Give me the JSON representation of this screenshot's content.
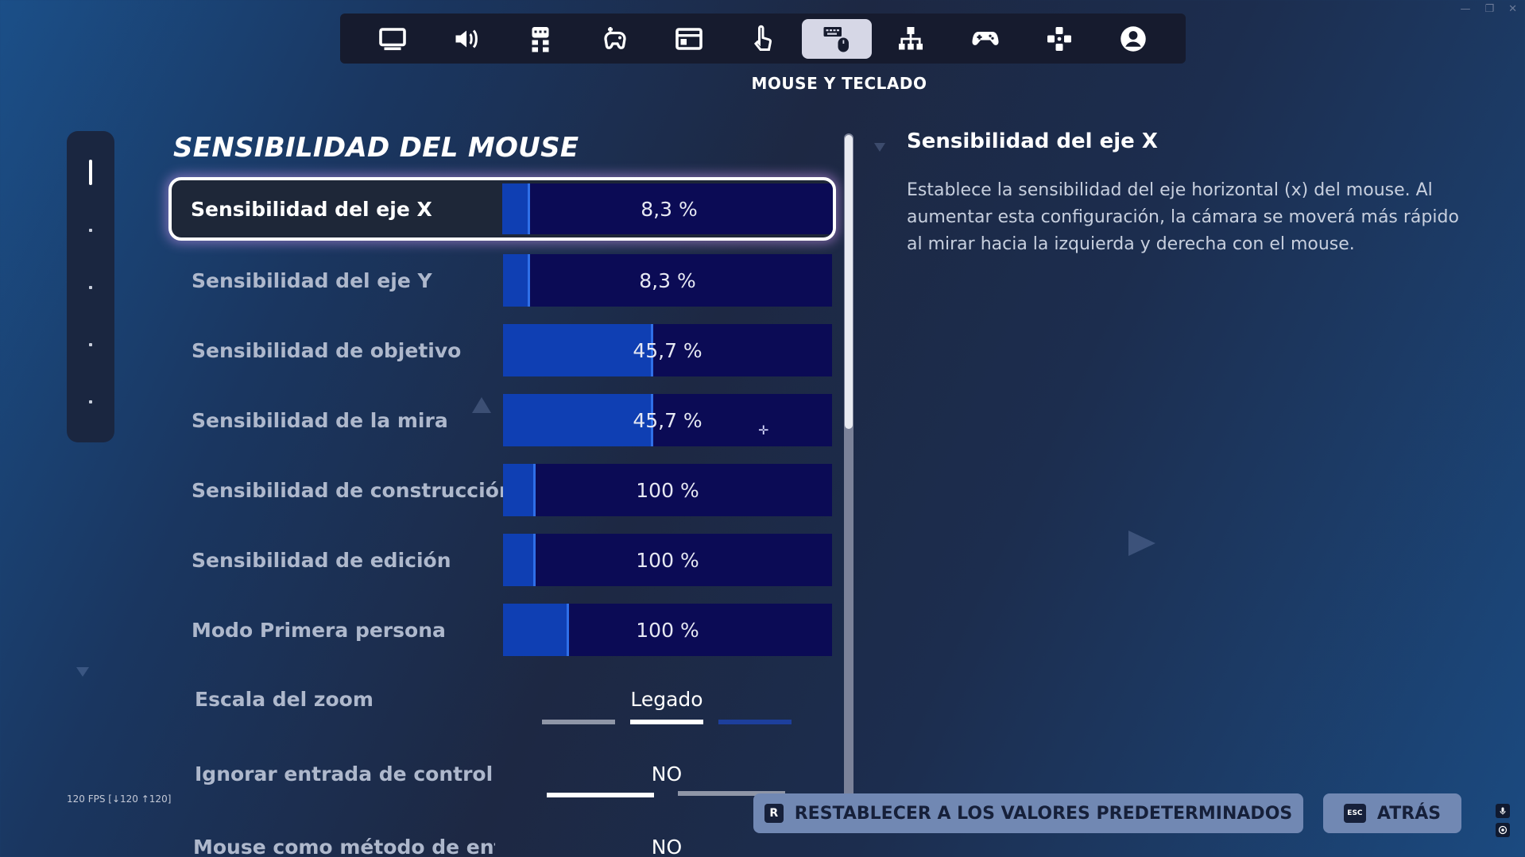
{
  "nav": {
    "tabs": [
      {
        "icon": "monitor-icon",
        "active": false
      },
      {
        "icon": "speaker-icon",
        "active": false
      },
      {
        "icon": "accessibility-grid-icon",
        "active": false
      },
      {
        "icon": "controller-touch-icon",
        "active": false
      },
      {
        "icon": "hud-icon",
        "active": false
      },
      {
        "icon": "touch-hand-icon",
        "active": false
      },
      {
        "icon": "keyboard-mouse-icon",
        "active": true
      },
      {
        "icon": "network-icon",
        "active": false
      },
      {
        "icon": "gamepad-icon",
        "active": false
      },
      {
        "icon": "dpad-icon",
        "active": false
      },
      {
        "icon": "account-icon",
        "active": false
      }
    ],
    "active_caption": "MOUSE Y TECLADO"
  },
  "section": {
    "title": "SENSIBILIDAD DEL MOUSE"
  },
  "settings": [
    {
      "label": "Sensibilidad del eje X",
      "value": "8,3 %",
      "fill": 0.083,
      "selected": true
    },
    {
      "label": "Sensibilidad del eje Y",
      "value": "8,3 %",
      "fill": 0.083,
      "selected": false
    },
    {
      "label": "Sensibilidad de objetivo",
      "value": "45,7 %",
      "fill": 0.457,
      "selected": false
    },
    {
      "label": "Sensibilidad de la mira",
      "value": "45,7 %",
      "fill": 0.457,
      "selected": false
    },
    {
      "label": "Sensibilidad de construcción",
      "value": "100 %",
      "fill": 0.1,
      "selected": false
    },
    {
      "label": "Sensibilidad de edición",
      "value": "100 %",
      "fill": 0.1,
      "selected": false
    },
    {
      "label": "Modo Primera persona",
      "value": "100 %",
      "fill": 0.2,
      "selected": false
    }
  ],
  "options": [
    {
      "label": "Escala del zoom",
      "value": "Legado",
      "option_count": 3,
      "selected_index": 1
    },
    {
      "label": "Ignorar entrada de control",
      "value": "NO",
      "option_count": 2,
      "selected_index": 0
    },
    {
      "label": "Mouse como método de entrada",
      "value": "NO"
    }
  ],
  "description": {
    "title": "Sensibilidad del eje X",
    "body": "Establece la sensibilidad del eje horizontal (x) del mouse. Al aumentar esta configuración, la cámara se moverá más rápido al mirar hacia la izquierda y derecha con el mouse."
  },
  "fps": "120 FPS [↓120 ↑120]",
  "actions": {
    "reset": {
      "key": "R",
      "label": "RESTABLECER A LOS VALORES PREDETERMINADOS"
    },
    "back": {
      "key": "ESC",
      "label": "ATRÁS"
    }
  },
  "colors": {
    "slider_track": "#0b0b55",
    "slider_fill": "#0f3fb3",
    "selected_border": "#ffffff",
    "button_bg": "#7188b3"
  }
}
